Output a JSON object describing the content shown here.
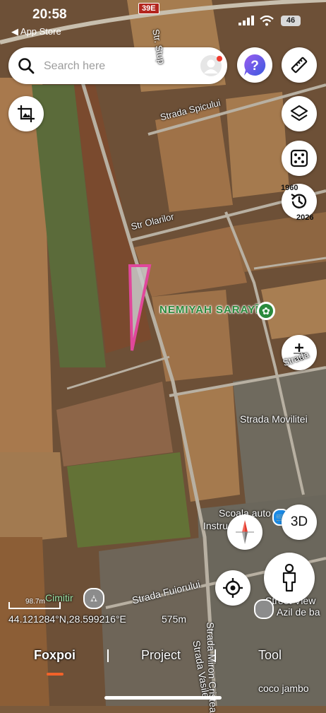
{
  "status_bar": {
    "time": "20:58",
    "back_label": "◀ App Store",
    "battery": "46"
  },
  "search": {
    "placeholder": "Search here"
  },
  "map_labels": {
    "road_shield": "39E",
    "str_stup": "Str. Stup",
    "strada_spicului": "Strada Spicului",
    "str_olarilor": "Str Olarilor",
    "poi_name": "NEMIYAH SARAYĪ",
    "strada_movilitei": "Strada Movilitei",
    "scoala_auto": "Scoala auto",
    "instructor": "Instructo",
    "strada_fuiorului": "Strada Fuiorului",
    "cimitir": "Cimitir",
    "street_view": "Street View",
    "azil": "Azil de ba",
    "strada_miron": "Strada Miron Cristea",
    "strada_vasile": "Strada Vasile",
    "coco_jambo": "coco jambo",
    "strada_partial": "Strada"
  },
  "timeline": {
    "start_year": "1960",
    "end_year": "2026"
  },
  "controls": {
    "btn_3d": "3D"
  },
  "scale": {
    "label": "98.7m"
  },
  "coordinates": {
    "text": "44.121284°N,28.599216°E",
    "distance": "575m"
  },
  "bottom_nav": {
    "items": [
      "Foxpoi",
      "Project",
      "Tool"
    ],
    "active": "Foxpoi"
  },
  "colors": {
    "accent": "#f2622a",
    "polygon_stroke": "#e0479b",
    "poi_green": "#2a8a3c",
    "help_purple": "#6a3bd6"
  },
  "icons": {
    "search": "search-icon",
    "avatar": "avatar",
    "help": "help-icon",
    "ruler": "ruler-icon",
    "layers": "layers-icon",
    "dice": "dice-icon",
    "history": "history-icon",
    "image_crop": "image-crop-icon",
    "zoom": "zoom-plus-minus-icon",
    "compass": "compass-icon",
    "locate": "my-location-icon",
    "pegman": "street-view-pegman-icon"
  }
}
